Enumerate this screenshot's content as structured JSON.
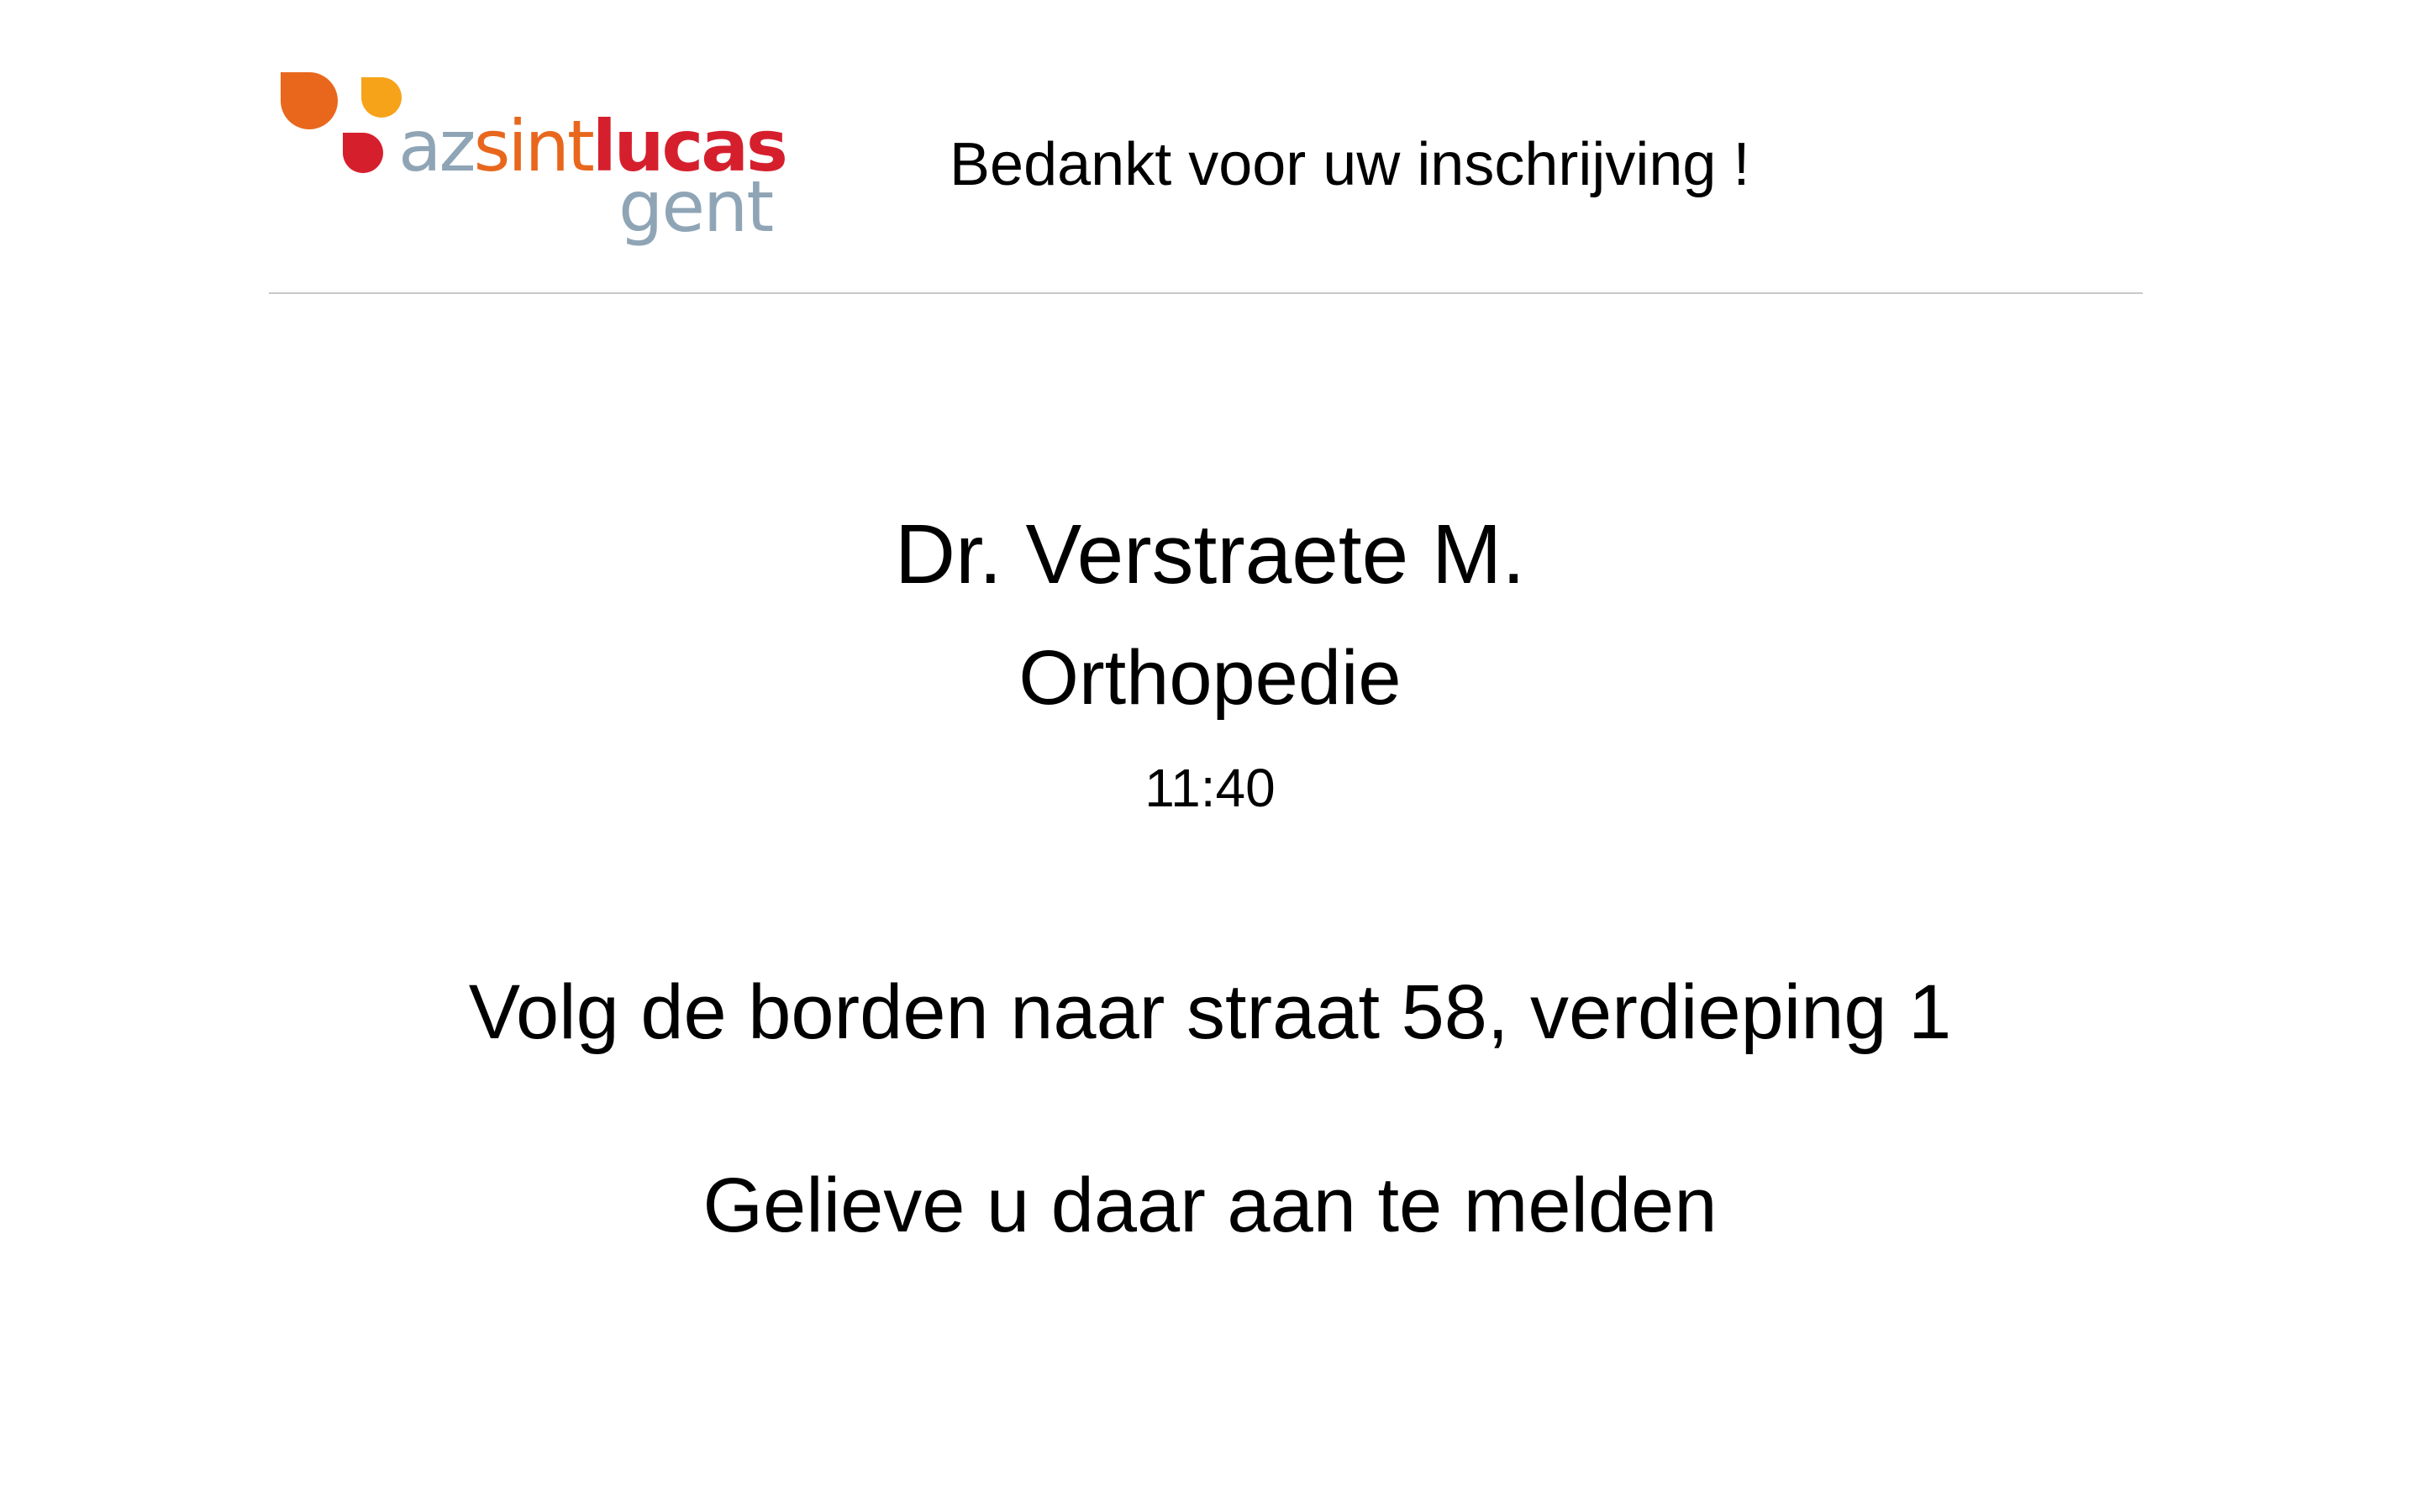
{
  "logo": {
    "brand_az": "az",
    "brand_sint": "sint",
    "brand_lucas": "lucas",
    "brand_city": "gent",
    "colors": {
      "orange": "#e8671d",
      "yellow": "#f6a31a",
      "red": "#d61f2d",
      "grey_blue": "#8fa5b6"
    }
  },
  "header": {
    "title": "Bedankt voor uw inschrijving !"
  },
  "appointment": {
    "doctor": "Dr. Verstraete M.",
    "specialty": "Orthopedie",
    "time": "11:40"
  },
  "instructions": {
    "directions": "Volg de borden naar straat 58, verdieping 1",
    "report": "Gelieve u daar aan te melden"
  }
}
